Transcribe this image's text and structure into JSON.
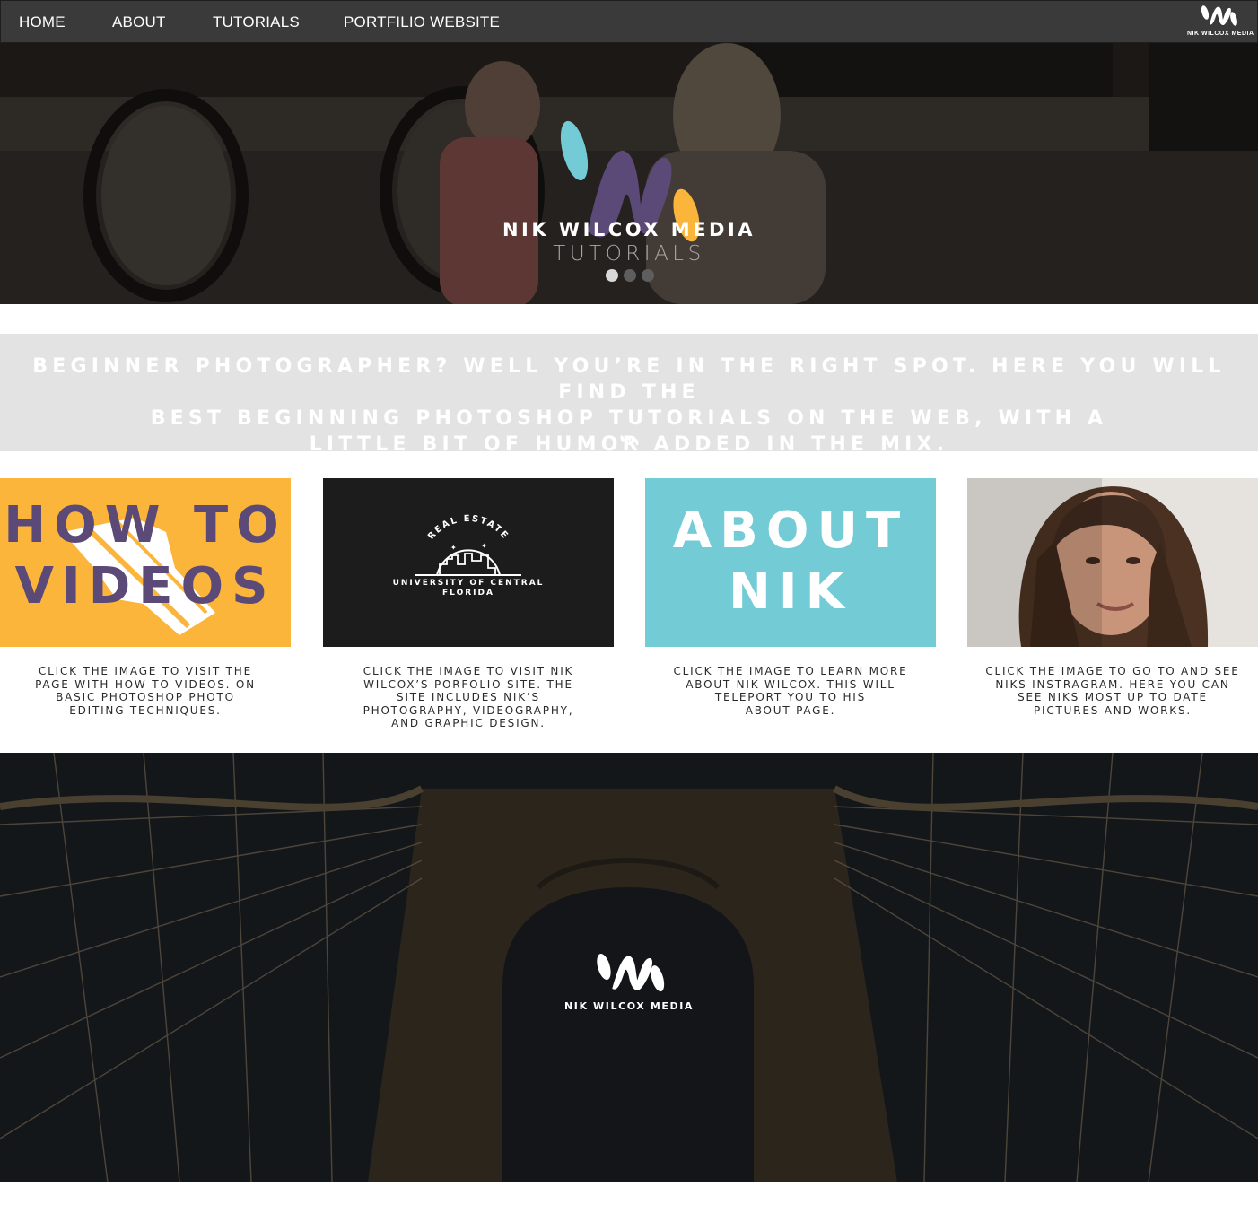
{
  "nav": {
    "items": [
      {
        "label": "HOME"
      },
      {
        "label": "ABOUT"
      },
      {
        "label": "TUTORIALS"
      },
      {
        "label": "PORTFILIO WEBSITE"
      }
    ],
    "logo_text": "NIK WILCOX MEDIA"
  },
  "hero": {
    "title": "NIK WILCOX MEDIA",
    "subtitle": "TUTORIALS",
    "slides_total": 3,
    "active_slide": 1,
    "logo_colors": {
      "teal": "#73cbd6",
      "purple": "#5b4978",
      "yellow": "#fbb53b"
    }
  },
  "intro": {
    "lines": [
      "BEGINNER PHOTOGRAPHER? WELL YOU’RE IN THE RIGHT SPOT. HERE YOU WILL FIND THE",
      "BEST BEGINNING PHOTOSHOP TUTORIALS ON THE WEB, WITH A",
      "LITTLE BIT OF HUMOR ADDED IN THE MIX."
    ]
  },
  "cards": [
    {
      "lines": [
        "HOW TO",
        "VIDEOS"
      ],
      "caption_lines": [
        "CLICK THE IMAGE TO VISIT THE",
        "PAGE WITH HOW TO VIDEOS. ON",
        "BASIC PHOTOSHOP PHOTO",
        "EDITING TECHNIQUES."
      ],
      "bg": "#fbb53b"
    },
    {
      "badge_arc": "REAL ESTATE",
      "badge_lines": [
        "UNIVERSITY OF CENTRAL",
        "FLORIDA"
      ],
      "caption_lines": [
        "CLICK THE IMAGE TO VISIT NIK",
        "WILCOX’S PORFOLIO SITE. THE",
        "SITE INCLUDES NIK’S",
        "PHOTOGRAPHY, VIDEOGRAPHY,",
        "AND GRAPHIC DESIGN."
      ],
      "bg": "#1c1c1c"
    },
    {
      "lines": [
        "ABOUT",
        "NIK"
      ],
      "caption_lines": [
        "CLICK THE IMAGE TO LEARN MORE",
        "ABOUT NIK WILCOX. THIS WILL",
        "TELEPORT YOU TO HIS",
        "ABOUT PAGE."
      ],
      "bg": "#73cbd6"
    },
    {
      "caption_lines": [
        "CLICK THE IMAGE TO GO TO AND SEE",
        "NIKS INSTRAGRAM. HERE YOU CAN",
        "SEE NIKS MOST UP TO DATE",
        "PICTURES AND WORKS."
      ],
      "bg": "#e5e2de"
    }
  ],
  "footer": {
    "logo_text": "NIK WILCOX MEDIA"
  }
}
